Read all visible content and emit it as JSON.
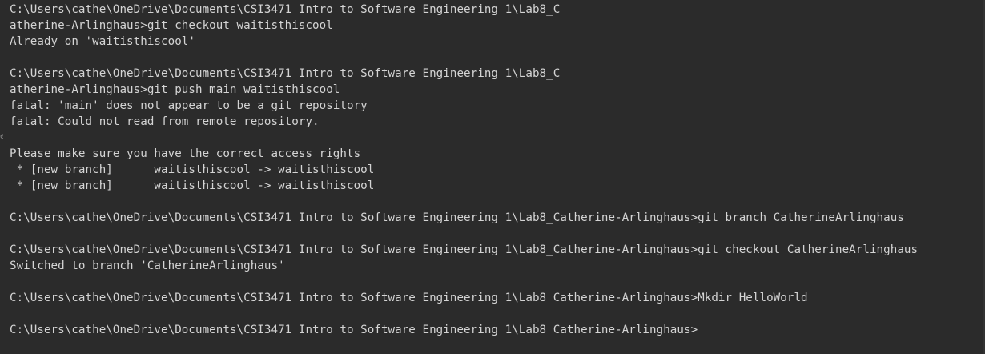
{
  "terminal": {
    "lines": [
      "C:\\Users\\cathe\\OneDrive\\Documents\\CSI3471 Intro to Software Engineering 1\\Lab8_C",
      "atherine-Arlinghaus>git checkout waitisthiscool",
      "Already on 'waitisthiscool'",
      "",
      "C:\\Users\\cathe\\OneDrive\\Documents\\CSI3471 Intro to Software Engineering 1\\Lab8_C",
      "atherine-Arlinghaus>git push main waitisthiscool",
      "fatal: 'main' does not appear to be a git repository",
      "fatal: Could not read from remote repository.",
      "",
      "Please make sure you have the correct access rights",
      " * [new branch]      waitisthiscool -> waitisthiscool",
      " * [new branch]      waitisthiscool -> waitisthiscool",
      "",
      "C:\\Users\\cathe\\OneDrive\\Documents\\CSI3471 Intro to Software Engineering 1\\Lab8_Catherine-Arlinghaus>git branch CatherineArlinghaus",
      "",
      "C:\\Users\\cathe\\OneDrive\\Documents\\CSI3471 Intro to Software Engineering 1\\Lab8_Catherine-Arlinghaus>git checkout CatherineArlinghaus",
      "Switched to branch 'CatherineArlinghaus'",
      "",
      "C:\\Users\\cathe\\OneDrive\\Documents\\CSI3471 Intro to Software Engineering 1\\Lab8_Catherine-Arlinghaus>Mkdir HelloWorld",
      "",
      "C:\\Users\\cathe\\OneDrive\\Documents\\CSI3471 Intro to Software Engineering 1\\Lab8_Catherine-Arlinghaus>"
    ],
    "left_edge_glyph": "e"
  },
  "colors": {
    "background": "#2b2b2b",
    "text": "#d4d4d4"
  }
}
